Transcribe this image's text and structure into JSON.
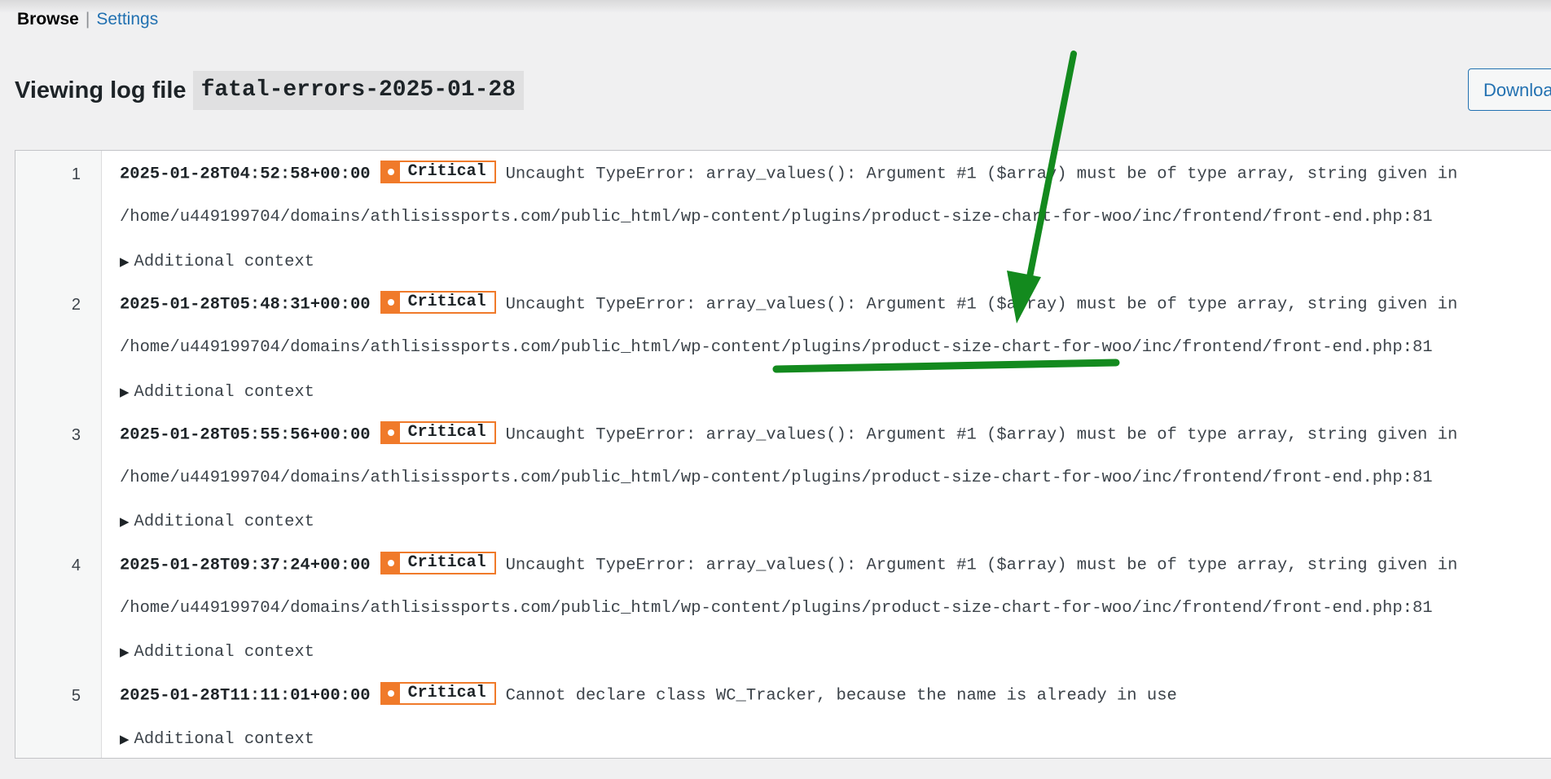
{
  "nav": {
    "browse_label": "Browse",
    "separator": "|",
    "settings_label": "Settings"
  },
  "heading": {
    "label": "Viewing log file",
    "filename": "fatal-errors-2025-01-28"
  },
  "download_button": {
    "label": "Download"
  },
  "entries": [
    {
      "num": "1",
      "timestamp": "2025-01-28T04:52:58+00:00",
      "level": "Critical",
      "message": "Uncaught TypeError: array_values(): Argument #1 ($array) must be of type array, string given in",
      "path": "/home/u449199704/domains/athlisissports.com/public_html/wp-content/plugins/product-size-chart-for-woo/inc/frontend/front-end.php:81",
      "context_label": "Additional context"
    },
    {
      "num": "2",
      "timestamp": "2025-01-28T05:48:31+00:00",
      "level": "Critical",
      "message": "Uncaught TypeError: array_values(): Argument #1 ($array) must be of type array, string given in",
      "path": "/home/u449199704/domains/athlisissports.com/public_html/wp-content/plugins/product-size-chart-for-woo/inc/frontend/front-end.php:81",
      "context_label": "Additional context"
    },
    {
      "num": "3",
      "timestamp": "2025-01-28T05:55:56+00:00",
      "level": "Critical",
      "message": "Uncaught TypeError: array_values(): Argument #1 ($array) must be of type array, string given in",
      "path": "/home/u449199704/domains/athlisissports.com/public_html/wp-content/plugins/product-size-chart-for-woo/inc/frontend/front-end.php:81",
      "context_label": "Additional context"
    },
    {
      "num": "4",
      "timestamp": "2025-01-28T09:37:24+00:00",
      "level": "Critical",
      "message": "Uncaught TypeError: array_values(): Argument #1 ($array) must be of type array, string given in",
      "path": "/home/u449199704/domains/athlisissports.com/public_html/wp-content/plugins/product-size-chart-for-woo/inc/frontend/front-end.php:81",
      "context_label": "Additional context"
    },
    {
      "num": "5",
      "timestamp": "2025-01-28T11:11:01+00:00",
      "level": "Critical",
      "message": "Cannot declare class WC_Tracker, because the name is already in use",
      "context_label": "Additional context"
    }
  ],
  "colors": {
    "critical": "#f07a2a",
    "link": "#2271b1",
    "annotation": "#138a1e"
  }
}
